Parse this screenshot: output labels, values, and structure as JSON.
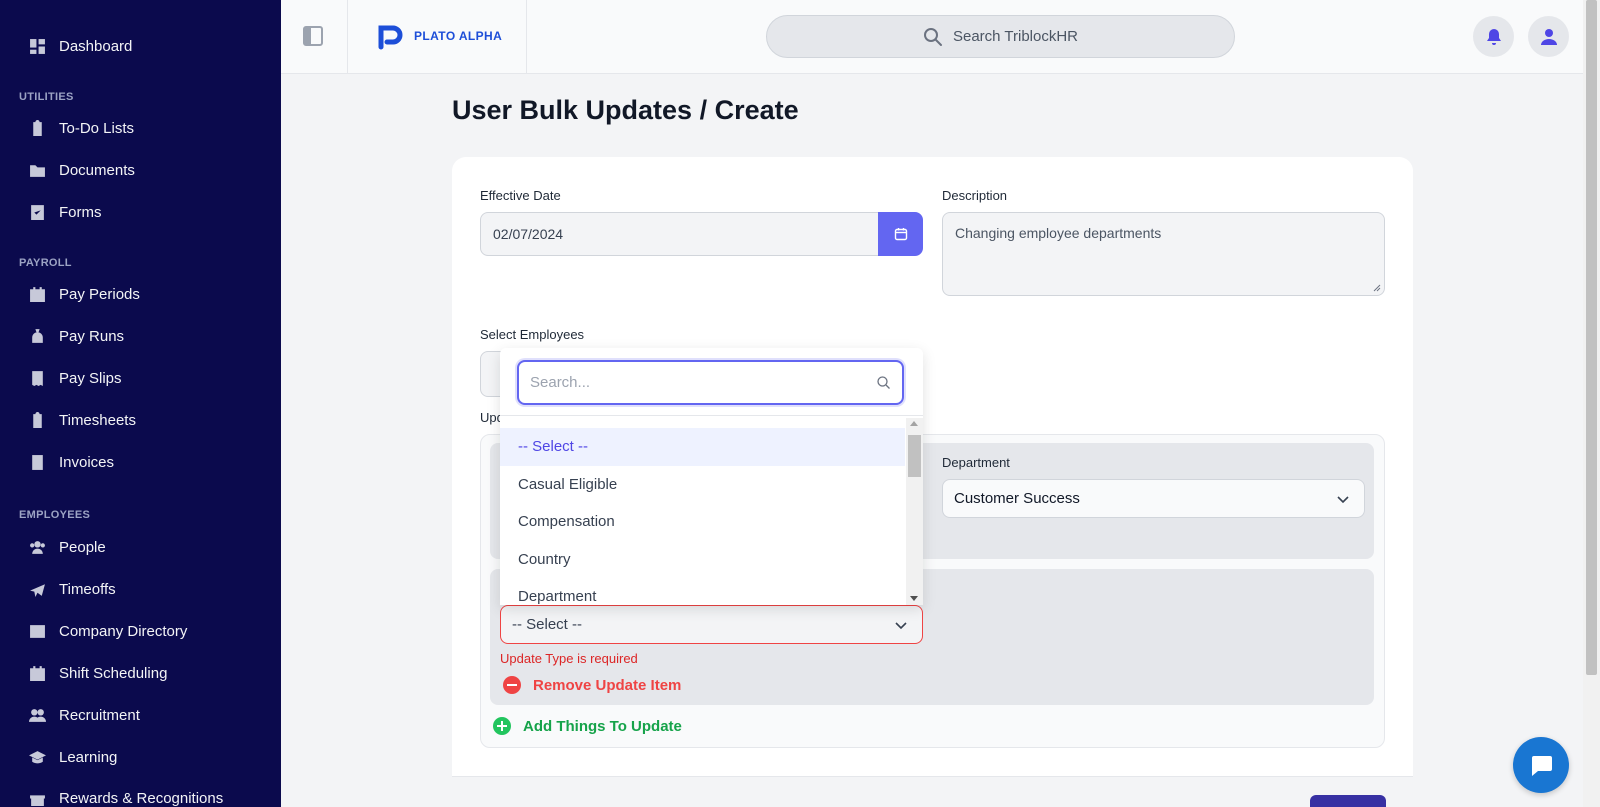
{
  "sidebar": {
    "items": [
      {
        "label": "Dashboard",
        "icon": "dashboard-icon"
      },
      {
        "label": "To-Do Lists",
        "icon": "clipboard-icon"
      },
      {
        "label": "Documents",
        "icon": "folder-icon"
      },
      {
        "label": "Forms",
        "icon": "checklist-icon"
      },
      {
        "label": "Pay Periods",
        "icon": "calendar-icon"
      },
      {
        "label": "Pay Runs",
        "icon": "money-bag-icon"
      },
      {
        "label": "Pay Slips",
        "icon": "receipt-icon"
      },
      {
        "label": "Timesheets",
        "icon": "clipboard-list-icon"
      },
      {
        "label": "Invoices",
        "icon": "invoice-icon"
      },
      {
        "label": "People",
        "icon": "people-icon"
      },
      {
        "label": "Timeoffs",
        "icon": "plane-icon"
      },
      {
        "label": "Company Directory",
        "icon": "id-card-icon"
      },
      {
        "label": "Shift Scheduling",
        "icon": "calendar-grid-icon"
      },
      {
        "label": "Recruitment",
        "icon": "user-group-icon"
      },
      {
        "label": "Learning",
        "icon": "graduation-cap-icon"
      },
      {
        "label": "Rewards & Recognitions",
        "icon": "gift-icon"
      }
    ],
    "sections": {
      "utilities": "UTILITIES",
      "payroll": "PAYROLL",
      "employees": "EMPLOYEES"
    }
  },
  "header": {
    "logo_text": "PLATO ALPHA",
    "search_placeholder": "Search TriblockHR"
  },
  "page": {
    "title": "User Bulk Updates / Create"
  },
  "form": {
    "effective_date_label": "Effective Date",
    "effective_date_value": "02/07/2024",
    "description_label": "Description",
    "description_value": "Changing employee departments",
    "select_employees_label": "Select Employees",
    "update_label_partial": "Upd",
    "department_label": "Department",
    "department_value": "Customer Success",
    "update_type_value": "-- Select --",
    "update_type_error": "Update Type is required",
    "remove_item_label": "Remove Update Item",
    "add_item_label": "Add Things To Update"
  },
  "dropdown": {
    "search_placeholder": "Search...",
    "options": [
      "-- Select --",
      "Casual Eligible",
      "Compensation",
      "Country",
      "Department"
    ],
    "active_index": 0
  },
  "colors": {
    "sidebar_bg": "#0b0a4d",
    "accent": "#6366f1",
    "error": "#ef4444",
    "success": "#16a34a"
  }
}
